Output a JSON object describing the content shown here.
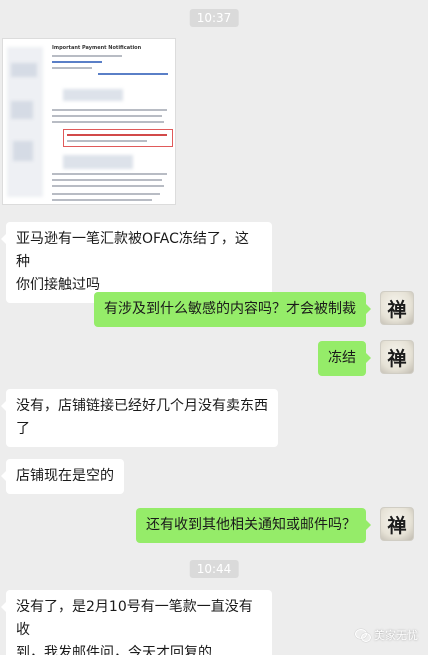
{
  "timestamps": [
    "10:37",
    "10:44"
  ],
  "image_message": {
    "heading_text": "Important Payment Notification"
  },
  "messages": [
    {
      "side": "left",
      "text_lines": [
        "亚马逊有一笔汇款被OFAC冻结了，这种",
        "你们接触过吗"
      ]
    },
    {
      "side": "right",
      "text_lines": [
        "有涉及到什么敏感的内容吗？才会被制裁"
      ],
      "avatar_char": "禅"
    },
    {
      "side": "right",
      "text_lines": [
        "冻结"
      ],
      "avatar_char": "禅"
    },
    {
      "side": "left",
      "text_lines": [
        "没有，店铺链接已经好几个月没有卖东西",
        "了"
      ]
    },
    {
      "side": "left",
      "text_lines": [
        "店铺现在是空的"
      ]
    },
    {
      "side": "right",
      "text_lines": [
        "还有收到其他相关通知或邮件吗？"
      ],
      "avatar_char": "禅"
    },
    {
      "side": "left",
      "text_lines": [
        "没有了，是2月10号有一笔款一直没有收",
        "到，我发邮件问，今天才回复的"
      ]
    }
  ],
  "watermark": {
    "text": "美家无忧",
    "icon": "wechat-official-account-icon"
  },
  "colors": {
    "background": "#ededed",
    "bubble_right": "#95ec69",
    "bubble_left": "#ffffff",
    "timestamp_bg": "#dadada"
  }
}
